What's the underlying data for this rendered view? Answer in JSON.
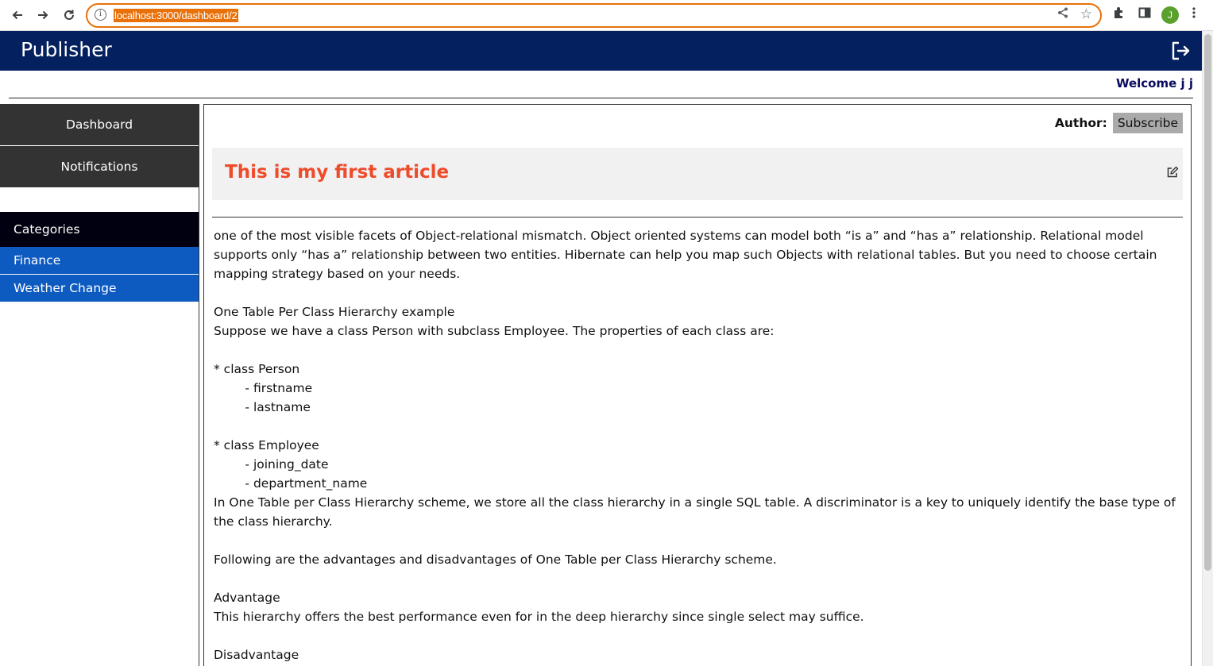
{
  "browser": {
    "url": "localhost:3000/dashboard/2",
    "avatar_initial": "J",
    "icons": {
      "back": "arrow-left-icon",
      "forward": "arrow-right-icon",
      "reload": "reload-icon",
      "info": "info-icon",
      "share": "share-icon",
      "bookmark": "star-icon",
      "extensions": "puzzle-icon",
      "sidepanel": "side-panel-icon",
      "menu": "kebab-menu-icon"
    },
    "accent": "#e8710a"
  },
  "app": {
    "title": "Publisher",
    "welcome": "Welcome j j",
    "header_color": "#04205f"
  },
  "sidebar": {
    "dashboard": "Dashboard",
    "notifications": "Notifications",
    "categories_heading": "Categories",
    "categories": [
      "Finance",
      "Weather Change"
    ],
    "category_color": "#0d5ac0"
  },
  "article": {
    "author_label": "Author:",
    "subscribe_label": "Subscribe",
    "title": "This is my first article",
    "title_color": "#ee4b2b",
    "body": "one of the most visible facets of Object-relational mismatch. Object oriented systems can model both “is a” and “has a” relationship. Relational model supports only “has a” relationship between two entities. Hibernate can help you map such Objects with relational tables. But you need to choose certain mapping strategy based on your needs.\n\nOne Table Per Class Hierarchy example\nSuppose we have a class Person with subclass Employee. The properties of each class are:\n\n* class Person\n        - firstname\n        - lastname\n\n* class Employee\n        - joining_date\n        - department_name\nIn One Table per Class Hierarchy scheme, we store all the class hierarchy in a single SQL table. A discriminator is a key to uniquely identify the base type of the class hierarchy.\n\nFollowing are the advantages and disadvantages of One Table per Class Hierarchy scheme.\n\nAdvantage\nThis hierarchy offers the best performance even for in the deep hierarchy since single select may suffice.\n\nDisadvantage"
  }
}
